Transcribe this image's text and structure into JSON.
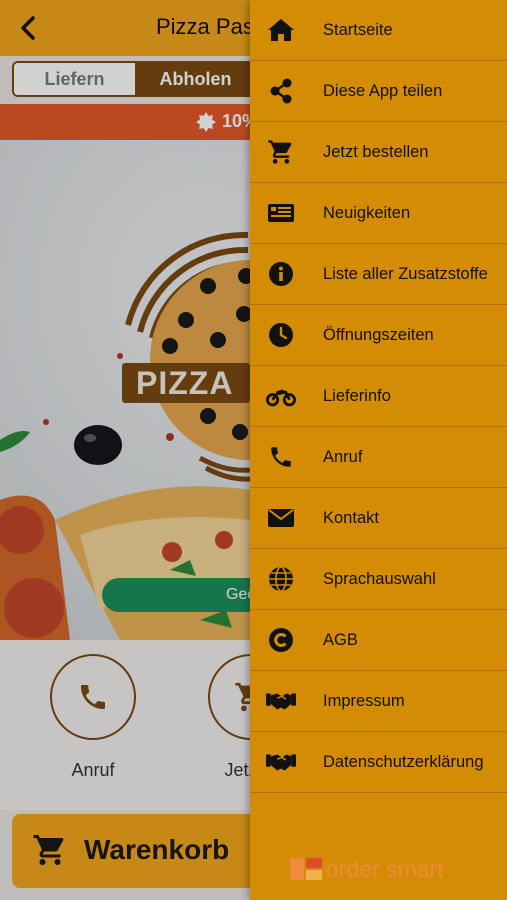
{
  "header": {
    "title": "Pizza Pasta"
  },
  "mode_toggle": {
    "options": [
      "Liefern",
      "Abholen"
    ],
    "selected": "Abholen"
  },
  "promo": {
    "text": "10%"
  },
  "hero": {
    "logo_text": "PIZZA",
    "status": "Geö"
  },
  "actions": [
    {
      "label": "Anruf",
      "icon": "phone-icon"
    },
    {
      "label": "Jetzt b",
      "icon": "cart-icon"
    }
  ],
  "cart": {
    "label": "Warenkorb"
  },
  "menu": {
    "items": [
      {
        "label": "Startseite",
        "icon": "home-icon"
      },
      {
        "label": "Diese App teilen",
        "icon": "share-icon"
      },
      {
        "label": "Jetzt bestellen",
        "icon": "cart-icon"
      },
      {
        "label": "Neuigkeiten",
        "icon": "newspaper-icon"
      },
      {
        "label": "Liste aller Zusatzstoffe",
        "icon": "info-icon"
      },
      {
        "label": "Öffnungszeiten",
        "icon": "clock-icon"
      },
      {
        "label": "Lieferinfo",
        "icon": "motorcycle-icon"
      },
      {
        "label": "Anruf",
        "icon": "phone-icon"
      },
      {
        "label": "Kontakt",
        "icon": "envelope-icon"
      },
      {
        "label": "Sprachauswahl",
        "icon": "globe-icon"
      },
      {
        "label": "AGB",
        "icon": "copyright-icon"
      },
      {
        "label": "Impressum",
        "icon": "handshake-icon"
      },
      {
        "label": "Datenschutzerklärung",
        "icon": "handshake-icon"
      }
    ],
    "brand": "order smart"
  },
  "colors": {
    "header": "#f2a71b",
    "drawer": "#d58c05",
    "accent_brown": "#7a4a12",
    "promo": "#e35a2a",
    "status_green": "#1d8f5c",
    "brand_orange": "#f08a3a"
  }
}
